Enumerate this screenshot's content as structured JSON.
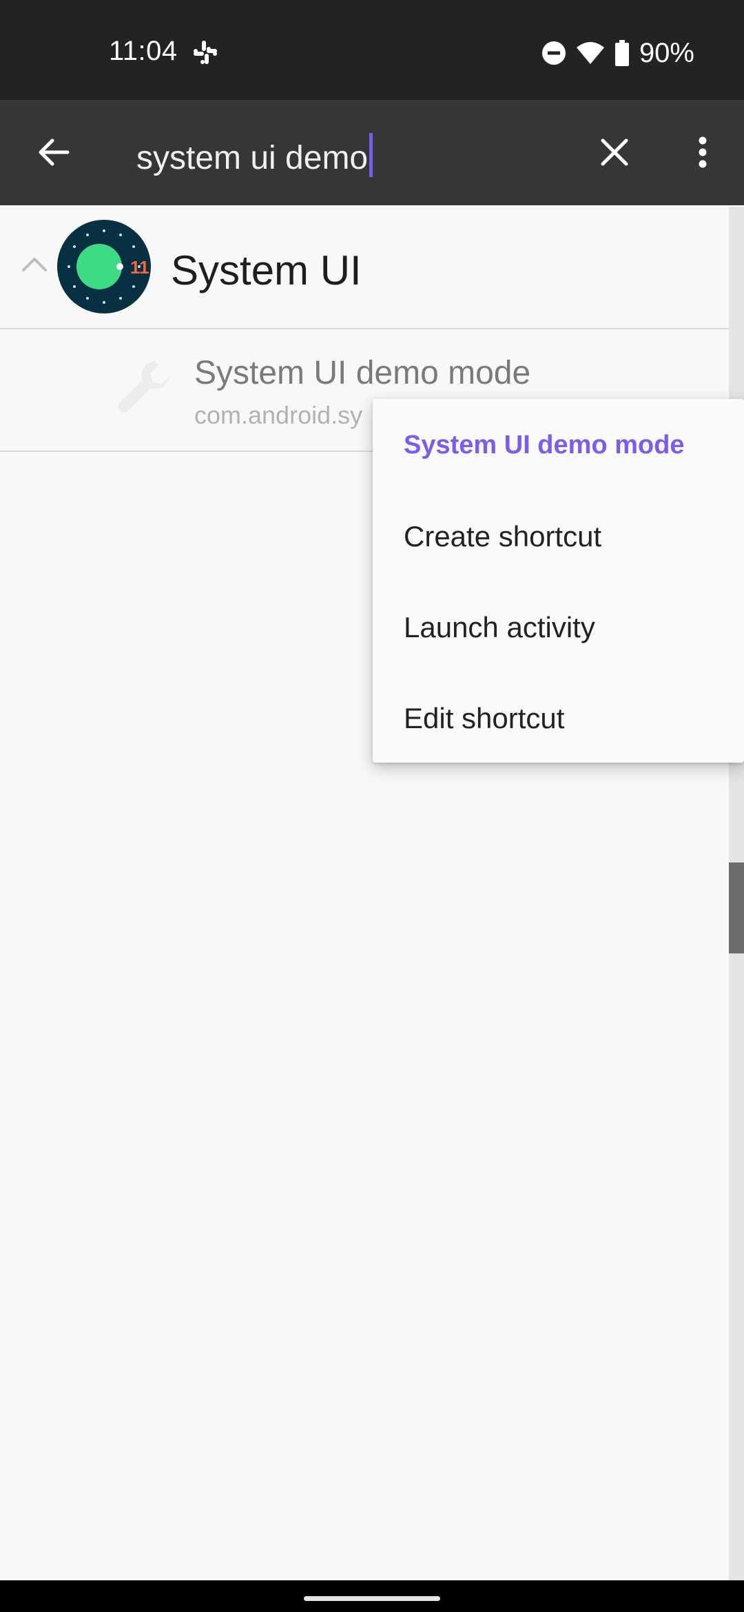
{
  "status_bar": {
    "time": "11:04",
    "battery_percent": "90%",
    "icons": [
      "slack-icon",
      "do-not-disturb-icon",
      "wifi-icon",
      "battery-icon"
    ]
  },
  "toolbar": {
    "search_value": "system ui demo",
    "icons": [
      "back-arrow-icon",
      "clear-icon",
      "more-vert-icon"
    ]
  },
  "list": {
    "group": {
      "title": "System UI",
      "icon": "android-11-icon",
      "expanded": true
    },
    "child": {
      "title": "System UI demo mode",
      "subtitle": "com.android.sy",
      "icon": "wrench-icon"
    }
  },
  "menu": {
    "header": "System UI demo mode",
    "items": [
      "Create shortcut",
      "Launch activity",
      "Edit shortcut"
    ]
  },
  "colors": {
    "accent": "#7b5cf0",
    "toolbar": "#363636",
    "status_bar": "#232323",
    "background": "#f8f8f8"
  },
  "scroll_position": 0.48
}
